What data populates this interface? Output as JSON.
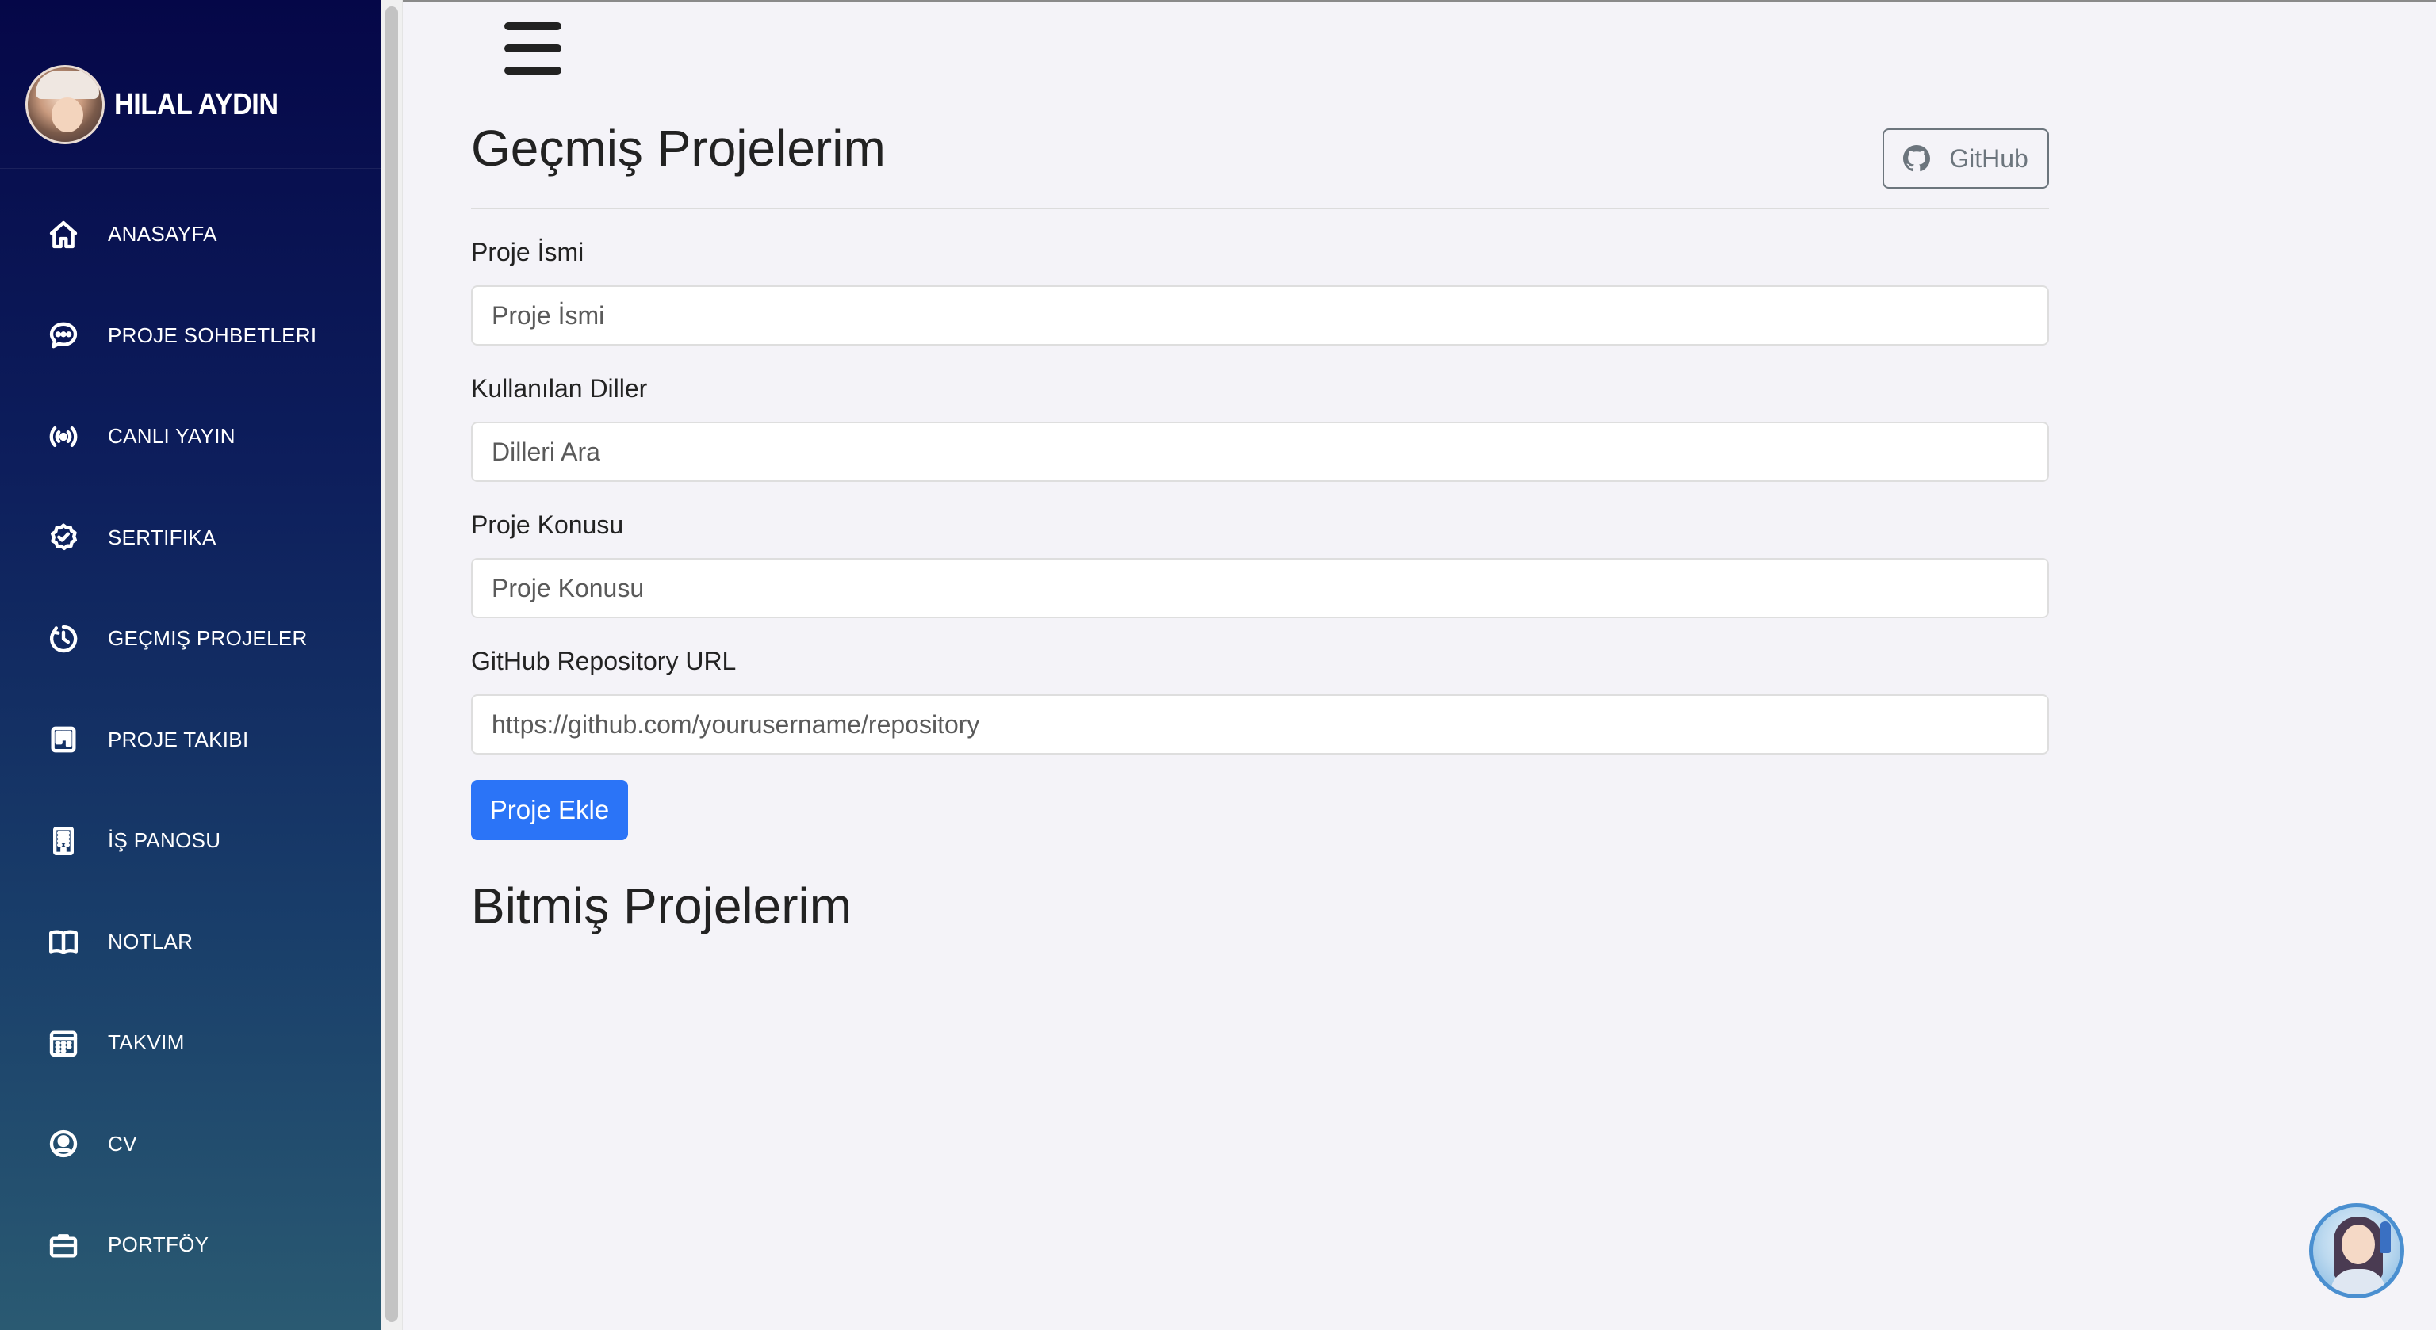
{
  "sidebar": {
    "profile_name": "HILAL AYDIN",
    "items": [
      {
        "label": "ANASAYFA",
        "icon": "home-icon"
      },
      {
        "label": "PROJE SOHBETLERI",
        "icon": "chat-icon"
      },
      {
        "label": "CANLI YAYIN",
        "icon": "broadcast-icon"
      },
      {
        "label": "SERTIFIKA",
        "icon": "certificate-icon"
      },
      {
        "label": "GEÇMIŞ PROJELER",
        "icon": "history-icon"
      },
      {
        "label": "PROJE TAKIBI",
        "icon": "kanban-icon"
      },
      {
        "label": "İŞ PANOSU",
        "icon": "building-icon"
      },
      {
        "label": "NOTLAR",
        "icon": "book-icon"
      },
      {
        "label": "TAKVIM",
        "icon": "calendar-icon"
      },
      {
        "label": "CV",
        "icon": "user-circle-icon"
      },
      {
        "label": "PORTFÖY",
        "icon": "briefcase-icon"
      }
    ]
  },
  "main": {
    "title": "Geçmiş Projelerim",
    "github_button": "GitHub",
    "form": {
      "name_label": "Proje İsmi",
      "name_placeholder": "Proje İsmi",
      "languages_label": "Kullanılan Diller",
      "languages_placeholder": "Dilleri Ara",
      "topic_label": "Proje Konusu",
      "topic_placeholder": "Proje Konusu",
      "repo_label": "GitHub Repository URL",
      "repo_placeholder": "https://github.com/yourusername/repository",
      "submit_label": "Proje Ekle"
    },
    "completed_title": "Bitmiş Projelerim"
  },
  "colors": {
    "sidebar_top": "#050748",
    "sidebar_bottom": "#2a5a72",
    "primary_button": "#2b74f7",
    "secondary_outline": "#6c757d",
    "background": "#f4f3f8"
  }
}
